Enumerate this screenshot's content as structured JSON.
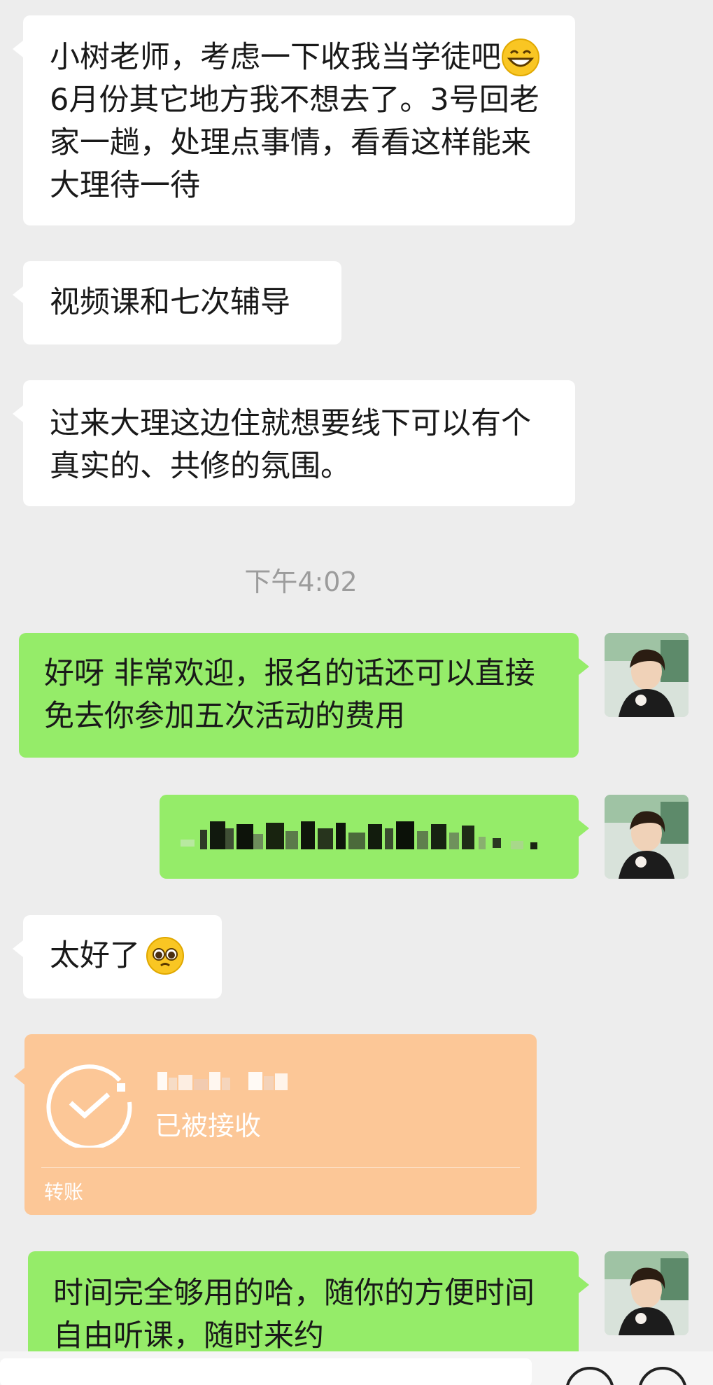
{
  "messages": [
    {
      "text_before_emoji": "小树老师，考虑一下收我当学徒吧",
      "emoji": "grinning-face-emoji",
      "text_after_emoji": " 6月份其它地方我不想去了。3号回老家一趟，处理点事情，看看这样能来大理待一待"
    },
    {
      "text": "视频课和七次辅导"
    },
    {
      "text": "过来大理这边住就想要线下可以有个真实的、共修的氛围。"
    },
    {
      "timestamp": "下午4:02"
    },
    {
      "text": "好呀 非常欢迎，报名的话还可以直接免去你参加五次活动的费用"
    },
    {
      "redacted": true
    },
    {
      "text": "太好了",
      "emoji": "pleading-face-emoji"
    },
    {
      "transfer": {
        "status": "已被接收",
        "label": "转账",
        "icon": "check-circle-icon",
        "color": "#fcc797"
      }
    },
    {
      "text": "时间完全够用的哈，随你的方便时间 自由听课，随时来约"
    }
  ],
  "colors": {
    "background": "#ededed",
    "incoming_bubble": "#ffffff",
    "outgoing_bubble": "#95ec69",
    "timestamp_text": "#9c9c9c"
  }
}
